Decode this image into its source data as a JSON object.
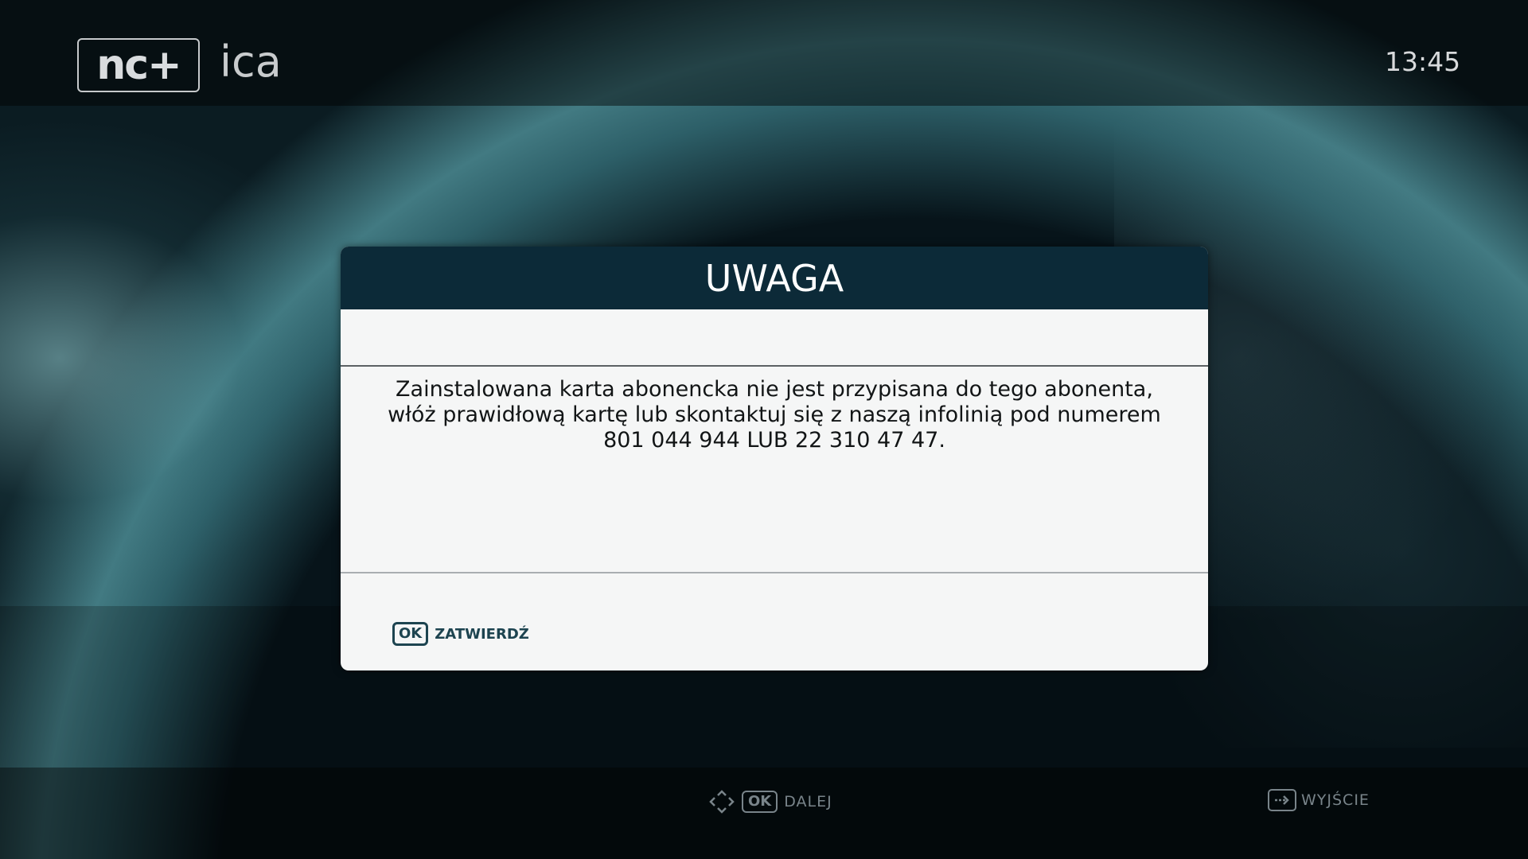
{
  "app": {
    "logo_text": "nc+",
    "logo_subtext": "ica",
    "clock": "13:45"
  },
  "dialog": {
    "title": "UWAGA",
    "message": "Zainstalowana karta abonencka nie jest przypisana do tego abonenta, włóż prawidłową kartę lub skontaktuj się z naszą infolinią pod numerem 801 044 944 LUB 22 310 47 47.",
    "ok_key": "OK",
    "ok_label": "ZATWIERDŹ"
  },
  "footer": {
    "next_key": "OK",
    "next_label": "DALEJ",
    "exit_label": "WYJŚCIE"
  },
  "icons": {
    "navigation": "arrows-icon",
    "exit": "exit-icon"
  },
  "colors": {
    "dialog_header": "#0c2a38",
    "dialog_body": "#f5f6f6",
    "key_accent": "#1d4450",
    "footer_text": "#79848a"
  }
}
